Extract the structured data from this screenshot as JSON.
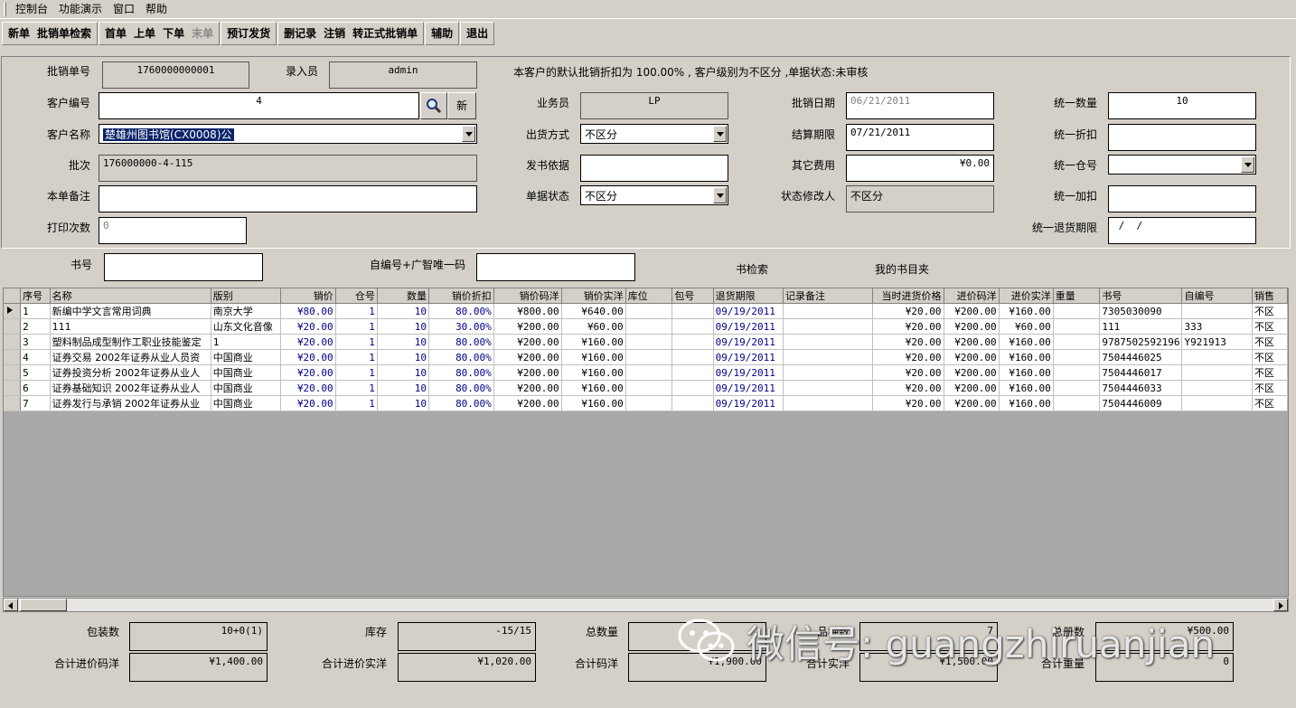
{
  "menu": [
    "控制台",
    "功能演示",
    "窗口",
    "帮助"
  ],
  "toolbar": {
    "groups": [
      [
        "新单",
        "批销单检索"
      ],
      [
        "首单",
        "上单",
        "下单",
        "末单"
      ],
      [
        "预订发货"
      ],
      [
        "删记录",
        "注销",
        "转正式批销单"
      ],
      [
        "辅助"
      ],
      [
        "退出"
      ]
    ],
    "disabled": [
      "末单"
    ]
  },
  "form": {
    "notice": "本客户的默认批销折扣为 100.00% , 客户级别为不区分 ,单据状态:未审核",
    "order_no_label": "批销单号",
    "order_no": "1760000000001",
    "entry_label": "录入员",
    "entry": "admin",
    "customer_no_label": "客户编号",
    "customer_no": "4",
    "new_button": "新",
    "customer_name_label": "客户名称",
    "customer_name": "楚雄州图书馆(CX0008)公",
    "batch_label": "批次",
    "batch": "176000000-4-115",
    "remark_label": "本单备注",
    "remark": "",
    "print_label": "打印次数",
    "print_count": "0",
    "salesman_label": "业务员",
    "salesman": "LP",
    "ship_label": "出货方式",
    "ship": "不区分",
    "basis_label": "发书依据",
    "basis": "",
    "status_label": "单据状态",
    "status": "不区分",
    "date_label": "批销日期",
    "date": "06/21/2011",
    "settle_label": "结算期限",
    "settle": "07/21/2011",
    "fee_label": "其它费用",
    "fee": "¥0.00",
    "modifier_label": "状态修改人",
    "modifier": "不区分",
    "uqty_label": "统一数量",
    "uqty": "10",
    "udisc_label": "统一折扣",
    "udisc": "",
    "uwh_label": "统一仓号",
    "uwh": "",
    "uadd_label": "统一加扣",
    "uadd": "",
    "uret_label": "统一退货期限",
    "uret": " /  /"
  },
  "search": {
    "isbn_label": "书号",
    "isbn": "",
    "code_label": "自编号+广智唯一码",
    "code": "",
    "search_link": "书检索",
    "folder_link": "我的书目夹"
  },
  "grid": {
    "columns": [
      "序号",
      "名称",
      "版别",
      "销价",
      "仓号",
      "数量",
      "销价折扣",
      "销价码洋",
      "销价实洋",
      "库位",
      "包号",
      "退货期限",
      "记录备注",
      "当时进货价格",
      "进价码洋",
      "进价实洋",
      "重量",
      "书号",
      "自编号",
      "销售"
    ],
    "rows": [
      [
        "1",
        "新编中学文言常用词典",
        "南京大学",
        "¥80.00",
        "1",
        "10",
        "80.00%",
        "¥800.00",
        "¥640.00",
        "",
        "",
        "09/19/2011",
        "",
        "¥20.00",
        "¥200.00",
        "¥160.00",
        "",
        "7305030090",
        "",
        "不区"
      ],
      [
        "2",
        "111",
        "山东文化音像",
        "¥20.00",
        "1",
        "10",
        "30.00%",
        "¥200.00",
        "¥60.00",
        "",
        "",
        "09/19/2011",
        "",
        "¥20.00",
        "¥200.00",
        "¥60.00",
        "",
        "111",
        "333",
        "不区"
      ],
      [
        "3",
        "塑料制品成型制作工职业技能鉴定",
        "1",
        "¥20.00",
        "1",
        "10",
        "80.00%",
        "¥200.00",
        "¥160.00",
        "",
        "",
        "09/19/2011",
        "",
        "¥20.00",
        "¥200.00",
        "¥160.00",
        "",
        "9787502592196",
        "Y921913",
        "不区"
      ],
      [
        "4",
        "证券交易 2002年证券从业人员资",
        "中国商业",
        "¥20.00",
        "1",
        "10",
        "80.00%",
        "¥200.00",
        "¥160.00",
        "",
        "",
        "09/19/2011",
        "",
        "¥20.00",
        "¥200.00",
        "¥160.00",
        "",
        "7504446025",
        "",
        "不区"
      ],
      [
        "5",
        "证券投资分析 2002年证券从业人",
        "中国商业",
        "¥20.00",
        "1",
        "10",
        "80.00%",
        "¥200.00",
        "¥160.00",
        "",
        "",
        "09/19/2011",
        "",
        "¥20.00",
        "¥200.00",
        "¥160.00",
        "",
        "7504446017",
        "",
        "不区"
      ],
      [
        "6",
        "证券基础知识 2002年证券从业人",
        "中国商业",
        "¥20.00",
        "1",
        "10",
        "80.00%",
        "¥200.00",
        "¥160.00",
        "",
        "",
        "09/19/2011",
        "",
        "¥20.00",
        "¥200.00",
        "¥160.00",
        "",
        "7504446033",
        "",
        "不区"
      ],
      [
        "7",
        "证券发行与承销 2002年证券从业",
        "中国商业",
        "¥20.00",
        "1",
        "10",
        "80.00%",
        "¥200.00",
        "¥160.00",
        "",
        "",
        "09/19/2011",
        "",
        "¥20.00",
        "¥200.00",
        "¥160.00",
        "",
        "7504446009",
        "",
        "不区"
      ]
    ]
  },
  "summary": {
    "pack_label": "包装数",
    "pack": "10+0(1)",
    "stock_label": "库存",
    "stock": "-15/15",
    "total_qty_label": "总数量",
    "total_qty": "",
    "kinds_label": "品种数",
    "kinds": "7",
    "total_books_label": "总册数",
    "total_books": "¥500.00",
    "in_price_label": "合计进价码洋",
    "in_price": "¥1,400.00",
    "in_real_label": "合计进价实洋",
    "in_real": "¥1,020.00",
    "code_label": "合计码洋",
    "code": "¥1,900.00",
    "real_label": "合计实洋",
    "real": "¥1,500.00",
    "weight_label": "合计重量",
    "weight": "0"
  },
  "watermark": "微信号: guangzhiruanjian"
}
